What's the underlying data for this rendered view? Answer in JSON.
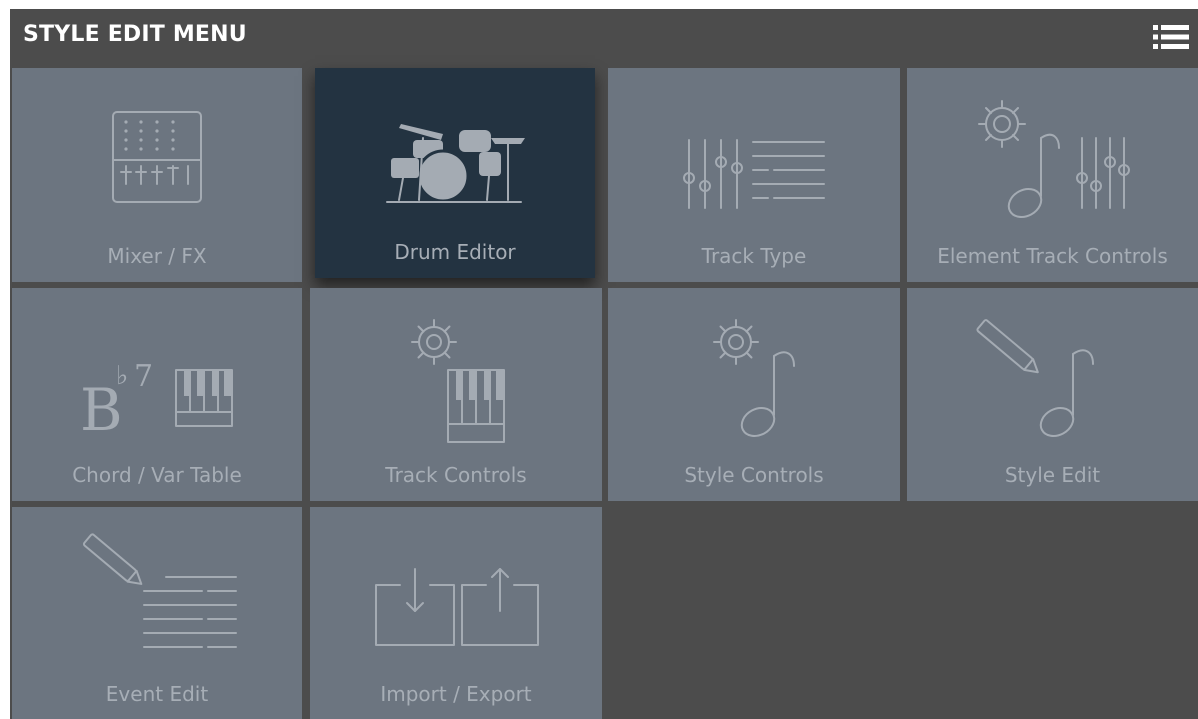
{
  "header": {
    "title": "STYLE EDIT MENU",
    "menu_icon": "list-menu-icon"
  },
  "colors": {
    "header_bg": "#4c4c4c",
    "tile_bg": "#6c7580",
    "tile_selected_bg": "#233341",
    "tile_text": "#a7aeb6",
    "header_text": "#ffffff"
  },
  "tiles": [
    {
      "label": "Mixer / FX",
      "icon": "mixer-icon",
      "selected": false
    },
    {
      "label": "Drum Editor",
      "icon": "drum-kit-icon",
      "selected": true
    },
    {
      "label": "Track Type",
      "icon": "sliders-list-icon",
      "selected": false
    },
    {
      "label": "Element Track Controls",
      "icon": "gear-note-sliders-icon",
      "selected": false
    },
    {
      "label": "Chord / Var Table",
      "icon": "chord-keyboard-icon",
      "selected": false
    },
    {
      "label": "Track Controls",
      "icon": "gear-keyboard-icon",
      "selected": false
    },
    {
      "label": "Style Controls",
      "icon": "gear-note-icon",
      "selected": false
    },
    {
      "label": "Style Edit",
      "icon": "pencil-note-icon",
      "selected": false
    },
    {
      "label": "Event Edit",
      "icon": "pencil-list-icon",
      "selected": false
    },
    {
      "label": "Import / Export",
      "icon": "import-export-icon",
      "selected": false
    }
  ],
  "chord_glyph": {
    "root": "B",
    "flat": "♭",
    "ext": "7"
  }
}
